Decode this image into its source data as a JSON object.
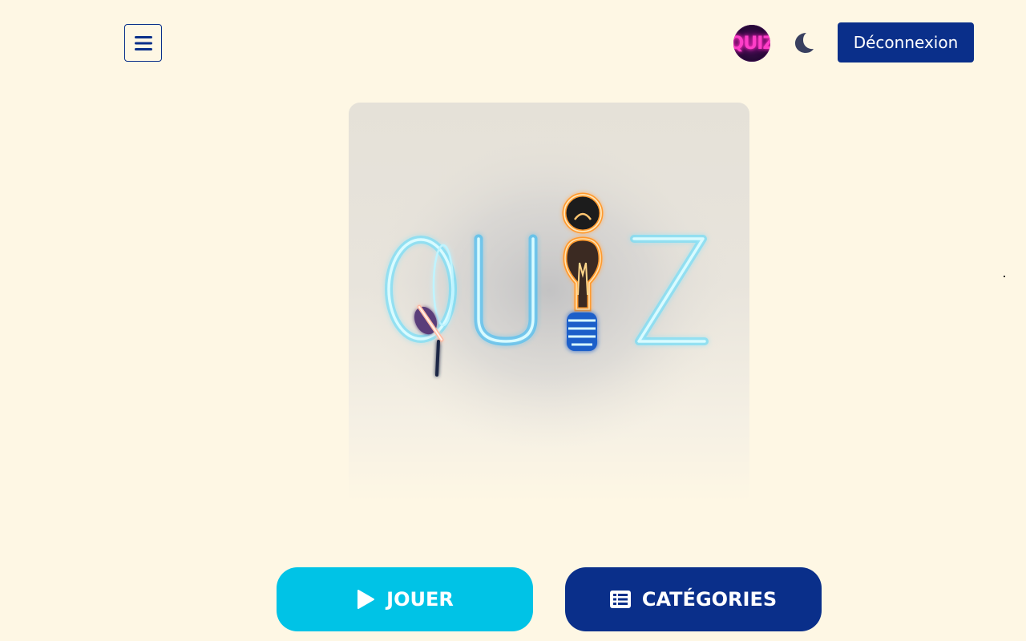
{
  "header": {
    "menu_icon": "hamburger-menu-icon",
    "avatar_text": "QUIZ",
    "theme_icon": "moon-icon",
    "logout_label": "Déconnexion"
  },
  "hero": {
    "image_text": "QUIZ"
  },
  "actions": {
    "play_label": "JOUER",
    "play_icon": "play-icon",
    "categories_label": "CATÉGORIES",
    "categories_icon": "list-icon"
  },
  "colors": {
    "background": "#fef7e4",
    "primary_dark": "#0a2f8a",
    "primary_cyan": "#00c3e6",
    "neon_blue": "#7fe8ff",
    "neon_orange": "#ff9a2e",
    "avatar_pink": "#ff3ec8"
  }
}
